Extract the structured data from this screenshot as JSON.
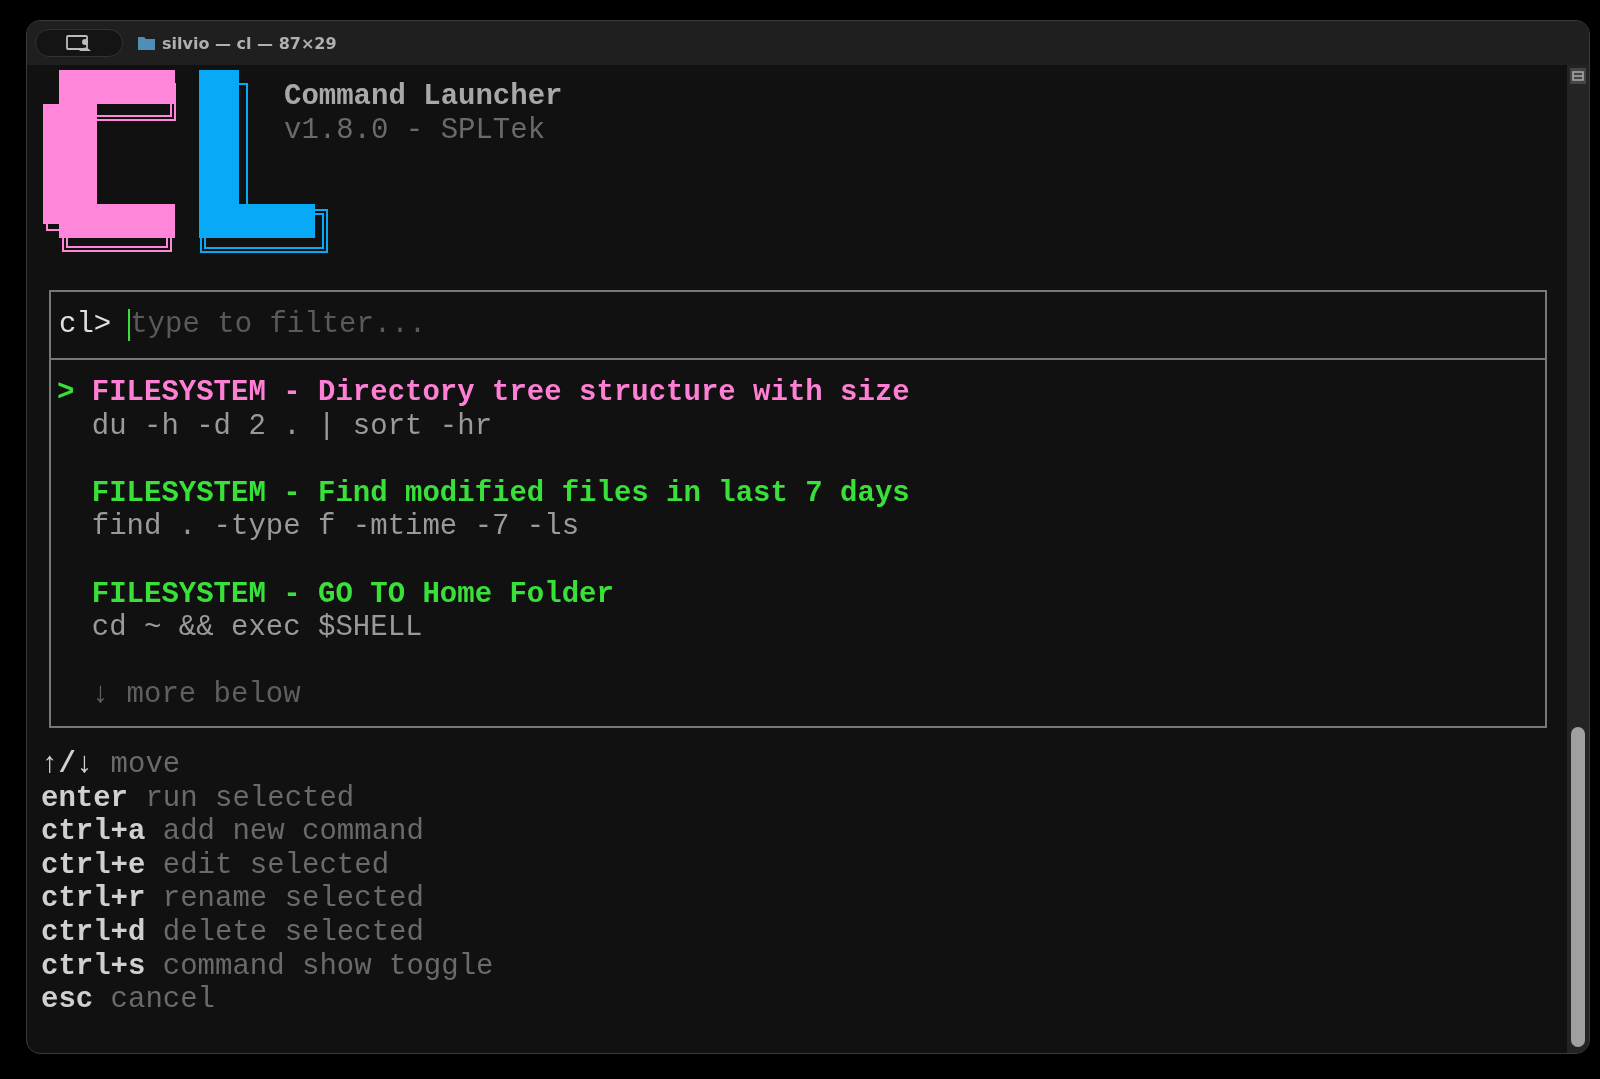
{
  "window": {
    "title": "silvio — cl — 87×29"
  },
  "header": {
    "title": "Command Launcher",
    "version": "v1.8.0 - SPLTek"
  },
  "filter": {
    "prompt": "cl>",
    "placeholder": "type to filter..."
  },
  "pointer": ">",
  "commands": [
    {
      "name": "FILESYSTEM - Directory tree structure with size",
      "command": "du -h -d 2 . | sort -hr",
      "selected": true
    },
    {
      "name": "FILESYSTEM - Find modified files in last 7 days",
      "command": "find . -type f -mtime -7 -ls",
      "selected": false
    },
    {
      "name": "FILESYSTEM - GO TO Home Folder",
      "command": "cd ~ && exec $SHELL",
      "selected": false
    }
  ],
  "more_hint": "↓ more below",
  "shortcuts": [
    {
      "key": "↑/↓",
      "action": "move"
    },
    {
      "key": "enter",
      "action": "run selected"
    },
    {
      "key": "ctrl+a",
      "action": "add new command"
    },
    {
      "key": "ctrl+e",
      "action": "edit selected"
    },
    {
      "key": "ctrl+r",
      "action": "rename selected"
    },
    {
      "key": "ctrl+d",
      "action": "delete selected"
    },
    {
      "key": "ctrl+s",
      "action": "command show toggle"
    },
    {
      "key": "esc",
      "action": "cancel"
    }
  ]
}
